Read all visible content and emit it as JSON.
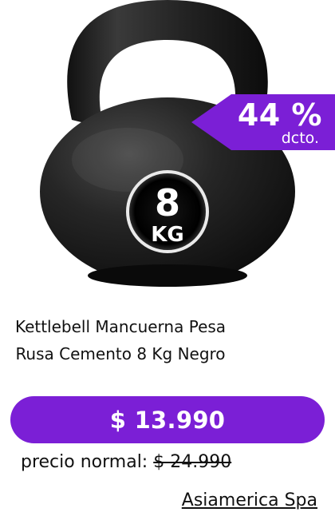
{
  "product": {
    "title": "Kettlebell  Mancuerna Pesa  Rusa Cemento 8 Kg Negro",
    "weight_label": {
      "number": "8",
      "unit": "KG"
    }
  },
  "discount": {
    "percent": "44 %",
    "label": "dcto."
  },
  "price": {
    "current": "$ 13.990",
    "normal_label": "precio normal:",
    "normal_value": "$ 24.990"
  },
  "seller": {
    "name": "Asiamerica Spa"
  },
  "colors": {
    "accent": "#7b1fd6",
    "kettlebell": "#1c1c1c",
    "text": "#111111",
    "background": "#ffffff"
  },
  "icons": {
    "product_image": "kettlebell-image"
  }
}
